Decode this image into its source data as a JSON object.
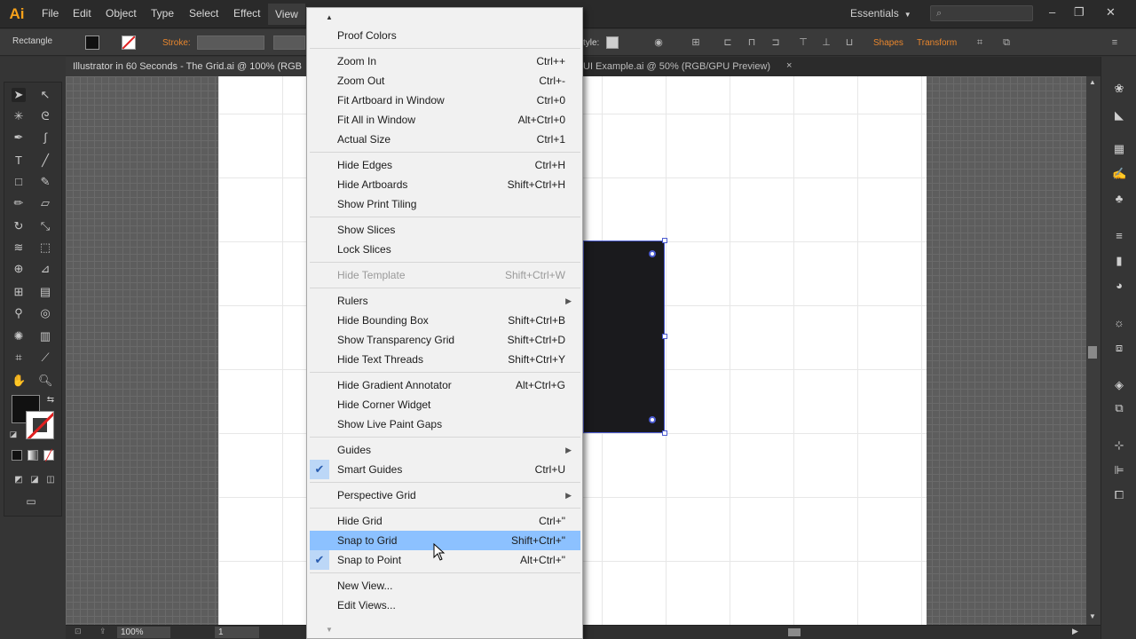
{
  "app": {
    "logo": "Ai"
  },
  "menubar": {
    "items": [
      "File",
      "Edit",
      "Object",
      "Type",
      "Select",
      "Effect",
      "View"
    ],
    "open_item": "View",
    "workspace": "Essentials",
    "search_icon": "search-icon",
    "window_controls": [
      "minimize-icon",
      "restore-icon",
      "close-icon"
    ]
  },
  "controlbar": {
    "tool_name": "Rectangle",
    "stroke_label": "Stroke:",
    "style_label": "tyle:",
    "shapes_label": "Shapes",
    "transform_label": "Transform",
    "accent_color": "#e8862d"
  },
  "tabs": [
    {
      "title": "Illustrator in 60 Seconds - The Grid.ai @ 100% (RGB",
      "active": true
    },
    {
      "title": "UI Example.ai @ 50% (RGB/GPU Preview)",
      "active": false,
      "close": "×"
    }
  ],
  "status": {
    "zoom": "100%",
    "page": "1"
  },
  "view_menu": {
    "groups": [
      [
        {
          "label": "Proof Colors",
          "shortcut": ""
        }
      ],
      [
        {
          "label": "Zoom In",
          "shortcut": "Ctrl++"
        },
        {
          "label": "Zoom Out",
          "shortcut": "Ctrl+-"
        },
        {
          "label": "Fit Artboard in Window",
          "shortcut": "Ctrl+0"
        },
        {
          "label": "Fit All in Window",
          "shortcut": "Alt+Ctrl+0"
        },
        {
          "label": "Actual Size",
          "shortcut": "Ctrl+1"
        }
      ],
      [
        {
          "label": "Hide Edges",
          "shortcut": "Ctrl+H"
        },
        {
          "label": "Hide Artboards",
          "shortcut": "Shift+Ctrl+H"
        },
        {
          "label": "Show Print Tiling",
          "shortcut": ""
        }
      ],
      [
        {
          "label": "Show Slices",
          "shortcut": ""
        },
        {
          "label": "Lock Slices",
          "shortcut": ""
        }
      ],
      [
        {
          "label": "Hide Template",
          "shortcut": "Shift+Ctrl+W",
          "disabled": true
        }
      ],
      [
        {
          "label": "Rulers",
          "shortcut": "",
          "submenu": true
        },
        {
          "label": "Hide Bounding Box",
          "shortcut": "Shift+Ctrl+B"
        },
        {
          "label": "Show Transparency Grid",
          "shortcut": "Shift+Ctrl+D"
        },
        {
          "label": "Hide Text Threads",
          "shortcut": "Shift+Ctrl+Y"
        }
      ],
      [
        {
          "label": "Hide Gradient Annotator",
          "shortcut": "Alt+Ctrl+G"
        },
        {
          "label": "Hide Corner Widget",
          "shortcut": ""
        },
        {
          "label": "Show Live Paint Gaps",
          "shortcut": ""
        }
      ],
      [
        {
          "label": "Guides",
          "shortcut": "",
          "submenu": true
        },
        {
          "label": "Smart Guides",
          "shortcut": "Ctrl+U",
          "checked": true
        }
      ],
      [
        {
          "label": "Perspective Grid",
          "shortcut": "",
          "submenu": true
        }
      ],
      [
        {
          "label": "Hide Grid",
          "shortcut": "Ctrl+\""
        },
        {
          "label": "Snap to Grid",
          "shortcut": "Shift+Ctrl+\"",
          "highlighted": true
        },
        {
          "label": "Snap to Point",
          "shortcut": "Alt+Ctrl+\"",
          "checked": true
        }
      ],
      [
        {
          "label": "New View...",
          "shortcut": ""
        },
        {
          "label": "Edit Views...",
          "shortcut": ""
        }
      ]
    ],
    "highlight_color": "#8cc1ff"
  },
  "canvas": {
    "shape_fill": "#1a1a1d",
    "selection_color": "#4b5bd0"
  }
}
